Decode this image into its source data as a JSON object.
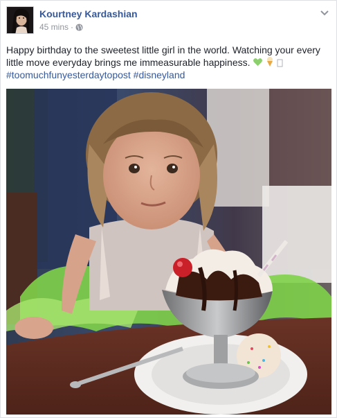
{
  "post": {
    "author": "Kourtney Kardashian",
    "time": "45 mins",
    "separator": "·",
    "privacy_icon": "globe-icon",
    "menu_icon": "chevron-down-icon",
    "text_line": "Happy birthday to the sweetest little girl in the world. Watching your every little move everyday brings me immeasurable happiness.",
    "hashtags": [
      "#toomuchfunyesterdaytopost",
      "#disneyland"
    ],
    "emojis": [
      "green-heart-icon",
      "ice-cream-cone-icon",
      "unknown-glyph-icon"
    ]
  },
  "colors": {
    "link": "#365899",
    "meta": "#90949c",
    "text": "#1d2129"
  }
}
